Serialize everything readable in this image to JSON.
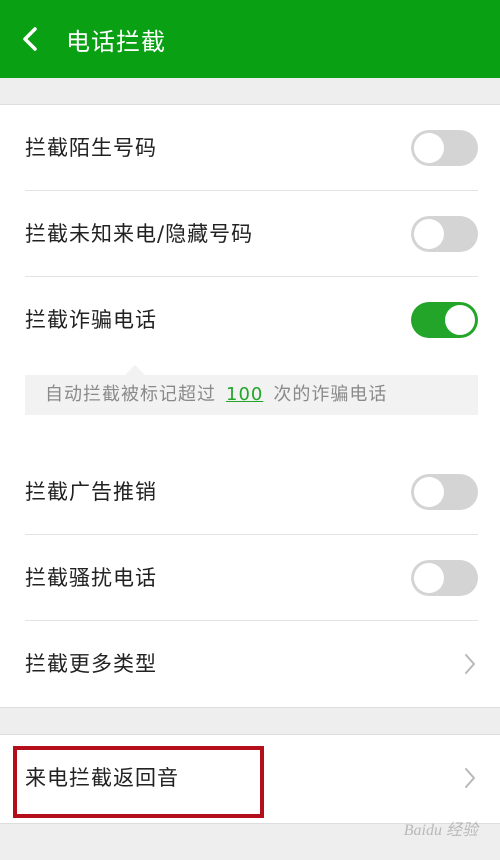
{
  "header": {
    "title": "电话拦截",
    "back_icon": "chevron-left-icon"
  },
  "colors": {
    "header_bg": "#0aa014",
    "toggle_on": "#23a52a",
    "highlight_border": "#b50e1b"
  },
  "settings": [
    {
      "label": "拦截陌生号码",
      "control": "toggle",
      "on": false
    },
    {
      "label": "拦截未知来电/隐藏号码",
      "control": "toggle",
      "on": false
    },
    {
      "label": "拦截诈骗电话",
      "control": "toggle",
      "on": true
    },
    {
      "label": "拦截广告推销",
      "control": "toggle",
      "on": false
    },
    {
      "label": "拦截骚扰电话",
      "control": "toggle",
      "on": false
    },
    {
      "label": "拦截更多类型",
      "control": "chevron"
    }
  ],
  "fraud_threshold": {
    "prefix": "自动拦截被标记超过",
    "count": "100",
    "suffix": "次的诈骗电话"
  },
  "section2": {
    "label": "来电拦截返回音"
  },
  "watermark": "Baidu 经验"
}
